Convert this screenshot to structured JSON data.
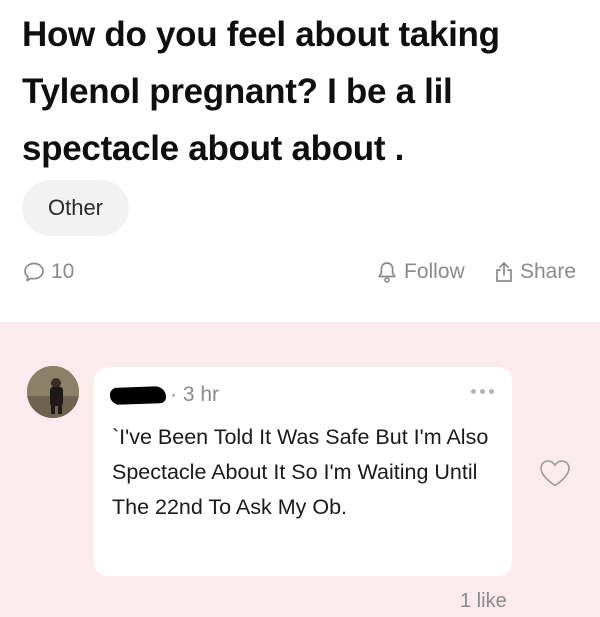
{
  "post": {
    "title": "How do you feel about taking Tylenol pregnant? I be a lil spectacle about about .",
    "tag": "Other"
  },
  "actions": {
    "comment_count": "10",
    "follow_label": "Follow",
    "share_label": "Share"
  },
  "comment": {
    "timestamp": "3 hr",
    "text": "`I've Been Told It Was Safe But I'm Also Spectacle About It So I'm Waiting Until The 22nd To Ask My Ob.",
    "likes": "1 like"
  },
  "colors": {
    "comments_background": "#fcebee",
    "muted_text": "#8a8a8a"
  },
  "icons": [
    "comment-icon",
    "bell-icon",
    "share-icon",
    "more-icon",
    "heart-icon"
  ]
}
